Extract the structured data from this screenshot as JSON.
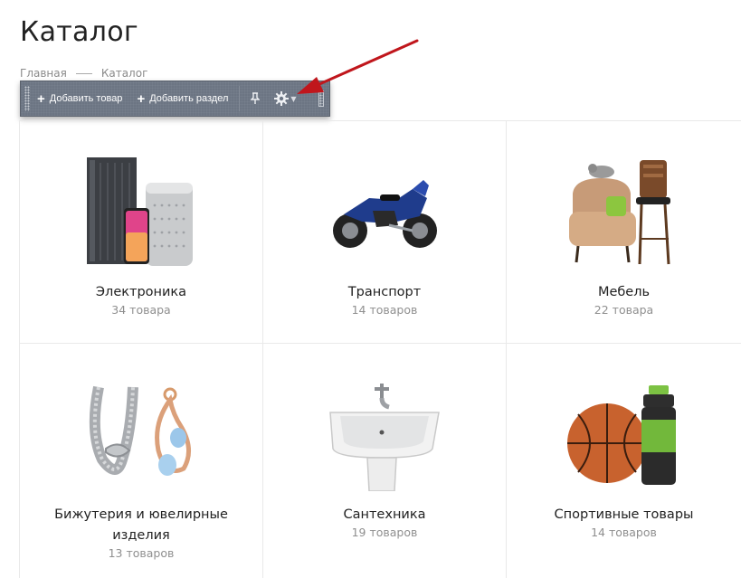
{
  "page": {
    "title": "Каталог"
  },
  "breadcrumb": {
    "items": [
      "Главная",
      "Каталог"
    ]
  },
  "toolbar": {
    "add_product_label": "Добавить товар",
    "add_section_label": "Добавить раздел",
    "icons": [
      "grip-icon",
      "plus-icon",
      "pin-icon",
      "gear-icon",
      "caret-down-icon"
    ]
  },
  "colors": {
    "toolbar_bg": "#6c7583",
    "arrow": "#c0161c"
  },
  "categories": [
    {
      "name": "Электроника",
      "count": "34 товара",
      "icon": "electronics-image"
    },
    {
      "name": "Транспорт",
      "count": "14 товаров",
      "icon": "motorcycle-image"
    },
    {
      "name": "Мебель",
      "count": "22 товара",
      "icon": "furniture-image"
    },
    {
      "name": "Бижутерия и ювелирные изделия",
      "count": "13 товаров",
      "icon": "jewelry-image"
    },
    {
      "name": "Сантехника",
      "count": "19 товаров",
      "icon": "sink-image"
    },
    {
      "name": "Спортивные товары",
      "count": "14 товаров",
      "icon": "sports-image"
    }
  ]
}
